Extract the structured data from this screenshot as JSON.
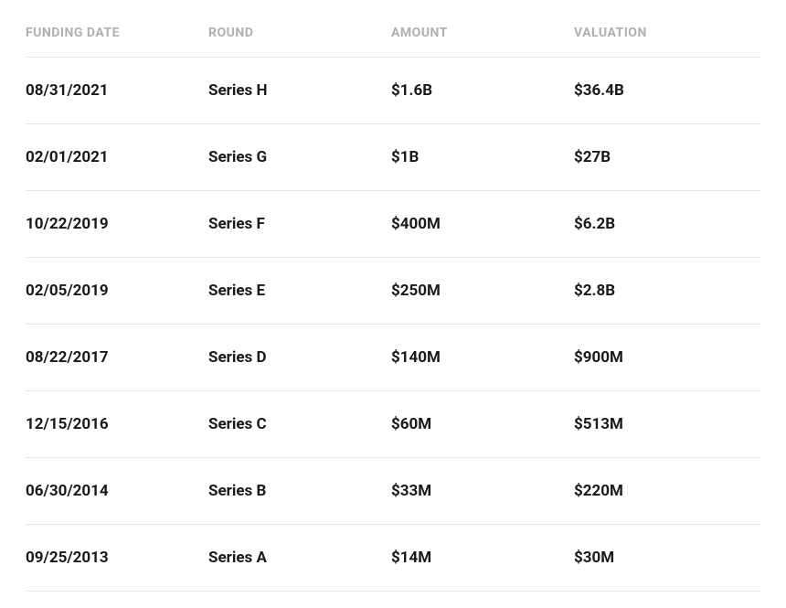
{
  "table": {
    "headers": {
      "funding_date": "FUNDING DATE",
      "round": "ROUND",
      "amount": "AMOUNT",
      "valuation": "VALUATION"
    },
    "rows": [
      {
        "date": "08/31/2021",
        "round": "Series H",
        "amount": "$1.6B",
        "valuation": "$36.4B"
      },
      {
        "date": "02/01/2021",
        "round": "Series G",
        "amount": "$1B",
        "valuation": "$27B"
      },
      {
        "date": "10/22/2019",
        "round": "Series F",
        "amount": "$400M",
        "valuation": "$6.2B"
      },
      {
        "date": "02/05/2019",
        "round": "Series E",
        "amount": "$250M",
        "valuation": "$2.8B"
      },
      {
        "date": "08/22/2017",
        "round": "Series D",
        "amount": "$140M",
        "valuation": "$900M"
      },
      {
        "date": "12/15/2016",
        "round": "Series C",
        "amount": "$60M",
        "valuation": "$513M"
      },
      {
        "date": "06/30/2014",
        "round": "Series B",
        "amount": "$33M",
        "valuation": "$220M"
      },
      {
        "date": "09/25/2013",
        "round": "Series A",
        "amount": "$14M",
        "valuation": "$30M"
      }
    ]
  }
}
